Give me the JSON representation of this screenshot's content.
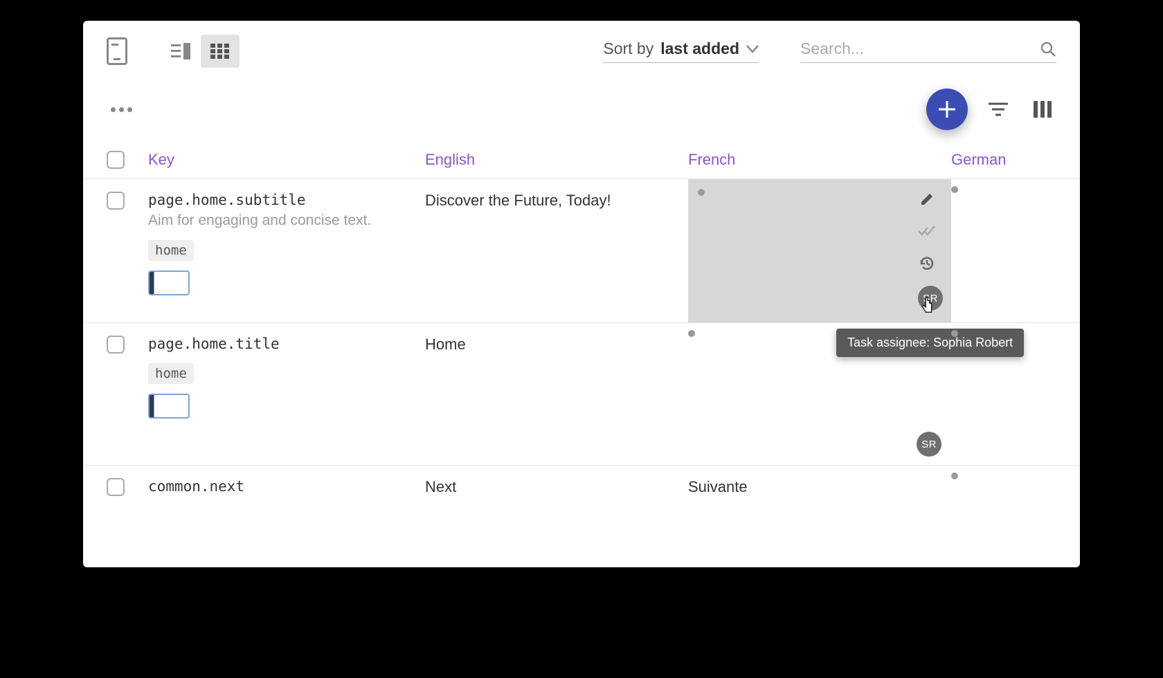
{
  "topbar": {
    "sort_prefix": "Sort by ",
    "sort_value": "last added"
  },
  "search": {
    "placeholder": "Search..."
  },
  "columns": {
    "key": "Key",
    "en": "English",
    "fr": "French",
    "de": "German"
  },
  "rows": [
    {
      "key": "page.home.subtitle",
      "desc": "Aim for engaging and concise text.",
      "tag": "home",
      "en": "Discover the Future, Today!",
      "fr": "",
      "de": "",
      "assignee_initials": "SR"
    },
    {
      "key": "page.home.title",
      "desc": "",
      "tag": "home",
      "en": "Home",
      "fr": "",
      "de": "",
      "assignee_initials": "SR"
    },
    {
      "key": "common.next",
      "desc": "",
      "tag": "",
      "en": "Next",
      "fr": "Suivante",
      "de": "",
      "assignee_initials": ""
    }
  ],
  "tooltip": {
    "text": "Task assignee: Sophia Robert"
  }
}
